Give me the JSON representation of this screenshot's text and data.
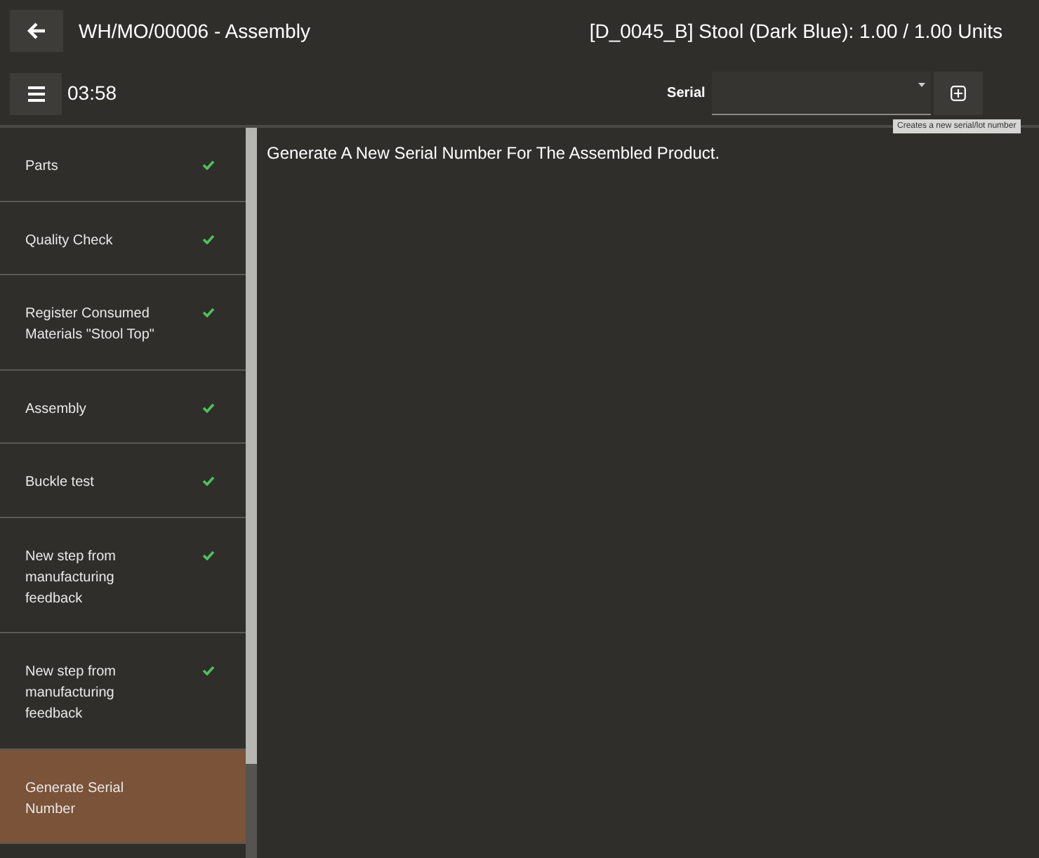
{
  "header": {
    "title": "WH/MO/00006 - Assembly",
    "product": "[D_0045_B] Stool (Dark Blue): 1.00 / 1.00 Units"
  },
  "toolbar": {
    "timer": "03:58",
    "serial_label": "Serial",
    "tooltip": "Creates a new serial/lot number"
  },
  "steps": [
    {
      "label": "Parts",
      "done": true,
      "selected": false
    },
    {
      "label": "Quality Check",
      "done": true,
      "selected": false
    },
    {
      "label": "Register Consumed Materials \"Stool Top\"",
      "done": true,
      "selected": false
    },
    {
      "label": "Assembly",
      "done": true,
      "selected": false
    },
    {
      "label": "Buckle test",
      "done": true,
      "selected": false
    },
    {
      "label": "New step from manufacturing feedback",
      "done": true,
      "selected": false
    },
    {
      "label": "New step from manufacturing feedback",
      "done": true,
      "selected": false
    },
    {
      "label": "Generate Serial Number",
      "done": false,
      "selected": true
    }
  ],
  "instruction": "Generate A New Serial Number For The Assembled Product."
}
